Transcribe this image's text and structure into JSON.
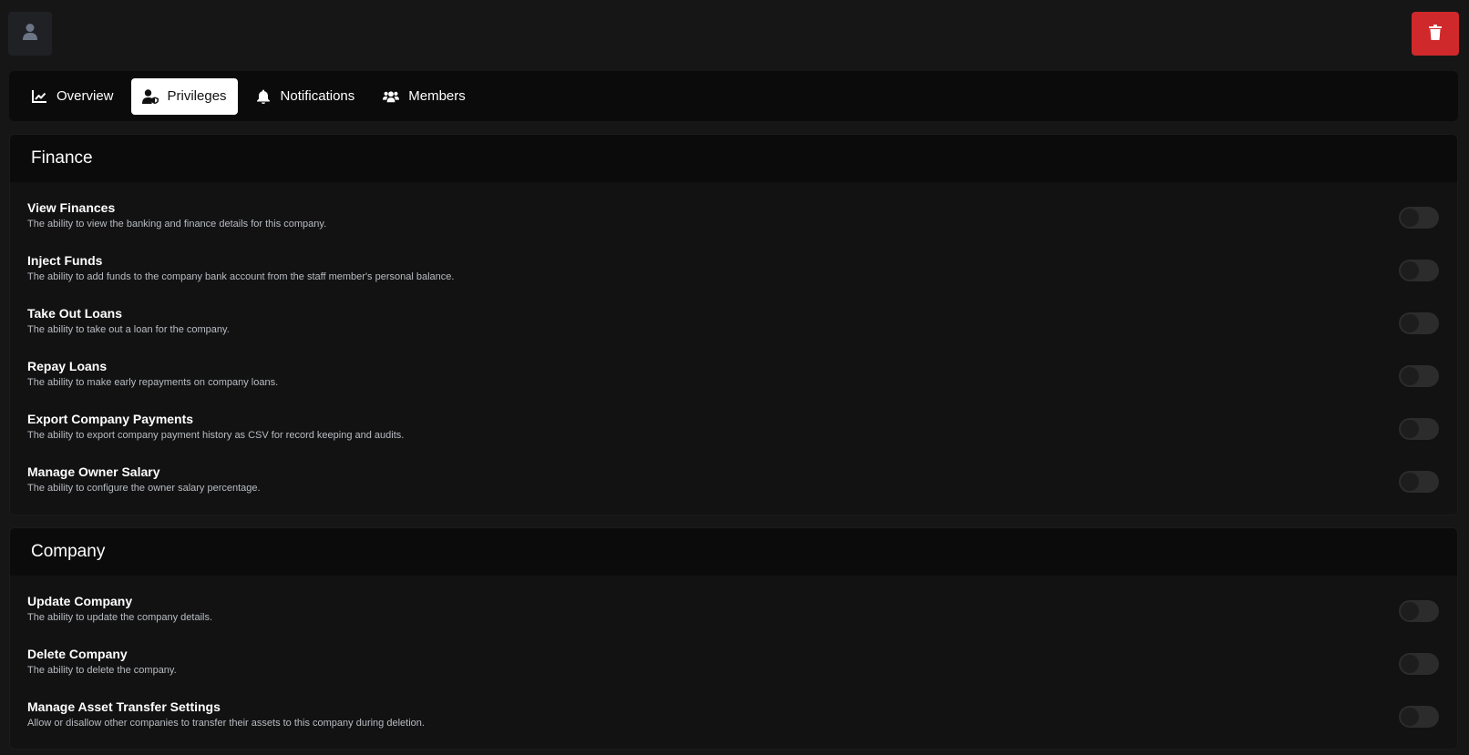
{
  "header": {
    "avatar_icon": "user-icon",
    "delete_icon": "trash-icon",
    "delete_color": "#d0292b"
  },
  "tabs": [
    {
      "label": "Overview",
      "icon": "chart-line-icon",
      "active": false
    },
    {
      "label": "Privileges",
      "icon": "user-shield-icon",
      "active": true
    },
    {
      "label": "Notifications",
      "icon": "bell-icon",
      "active": false
    },
    {
      "label": "Members",
      "icon": "users-icon",
      "active": false
    }
  ],
  "sections": [
    {
      "title": "Finance",
      "privileges": [
        {
          "title": "View Finances",
          "description": "The ability to view the banking and finance details for this company.",
          "enabled": false
        },
        {
          "title": "Inject Funds",
          "description": "The ability to add funds to the company bank account from the staff member's personal balance.",
          "enabled": false
        },
        {
          "title": "Take Out Loans",
          "description": "The ability to take out a loan for the company.",
          "enabled": false
        },
        {
          "title": "Repay Loans",
          "description": "The ability to make early repayments on company loans.",
          "enabled": false
        },
        {
          "title": "Export Company Payments",
          "description": "The ability to export company payment history as CSV for record keeping and audits.",
          "enabled": false
        },
        {
          "title": "Manage Owner Salary",
          "description": "The ability to configure the owner salary percentage.",
          "enabled": false
        }
      ]
    },
    {
      "title": "Company",
      "privileges": [
        {
          "title": "Update Company",
          "description": "The ability to update the company details.",
          "enabled": false
        },
        {
          "title": "Delete Company",
          "description": "The ability to delete the company.",
          "enabled": false
        },
        {
          "title": "Manage Asset Transfer Settings",
          "description": "Allow or disallow other companies to transfer their assets to this company during deletion.",
          "enabled": false
        }
      ]
    }
  ]
}
